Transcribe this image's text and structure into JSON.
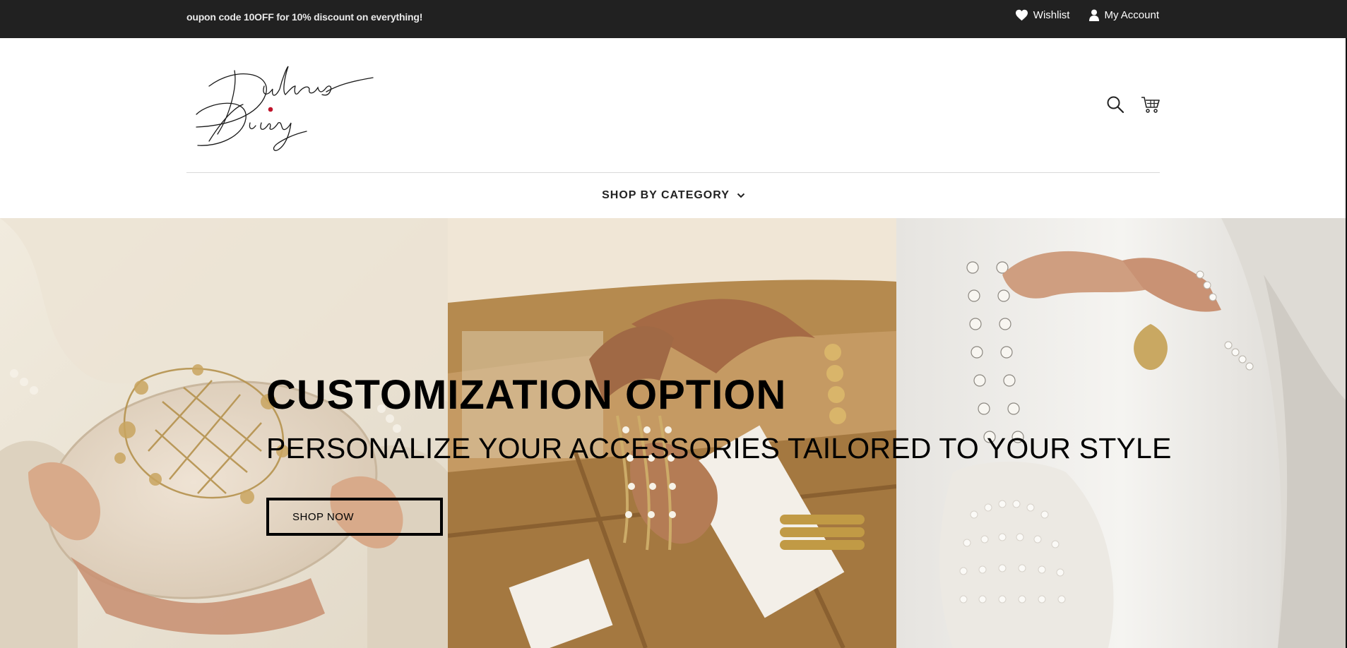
{
  "announcement": {
    "text": "oupon code 10OFF for 10% discount on everything!"
  },
  "top_links": [
    {
      "label": "Wishlist",
      "icon": "heart-icon"
    },
    {
      "label": "My Account",
      "icon": "user-icon"
    }
  ],
  "logo": {
    "text": "Dulhans Diary"
  },
  "header_icons": [
    "search-icon",
    "cart-icon"
  ],
  "nav": {
    "items": [
      {
        "label": "SHOP BY CATEGORY",
        "icon": "chevron-down-icon"
      }
    ]
  },
  "hero": {
    "title": "CUSTOMIZATION OPTION",
    "subtitle": "PERSONALIZE YOUR ACCESSORIES TAILORED TO YOUR STYLE",
    "button_label": "SHOP NOW"
  },
  "colors": {
    "topbar": "#212121",
    "text_dark": "#000000",
    "divider": "#d9d9d9",
    "logo_dot": "#c0142b"
  }
}
